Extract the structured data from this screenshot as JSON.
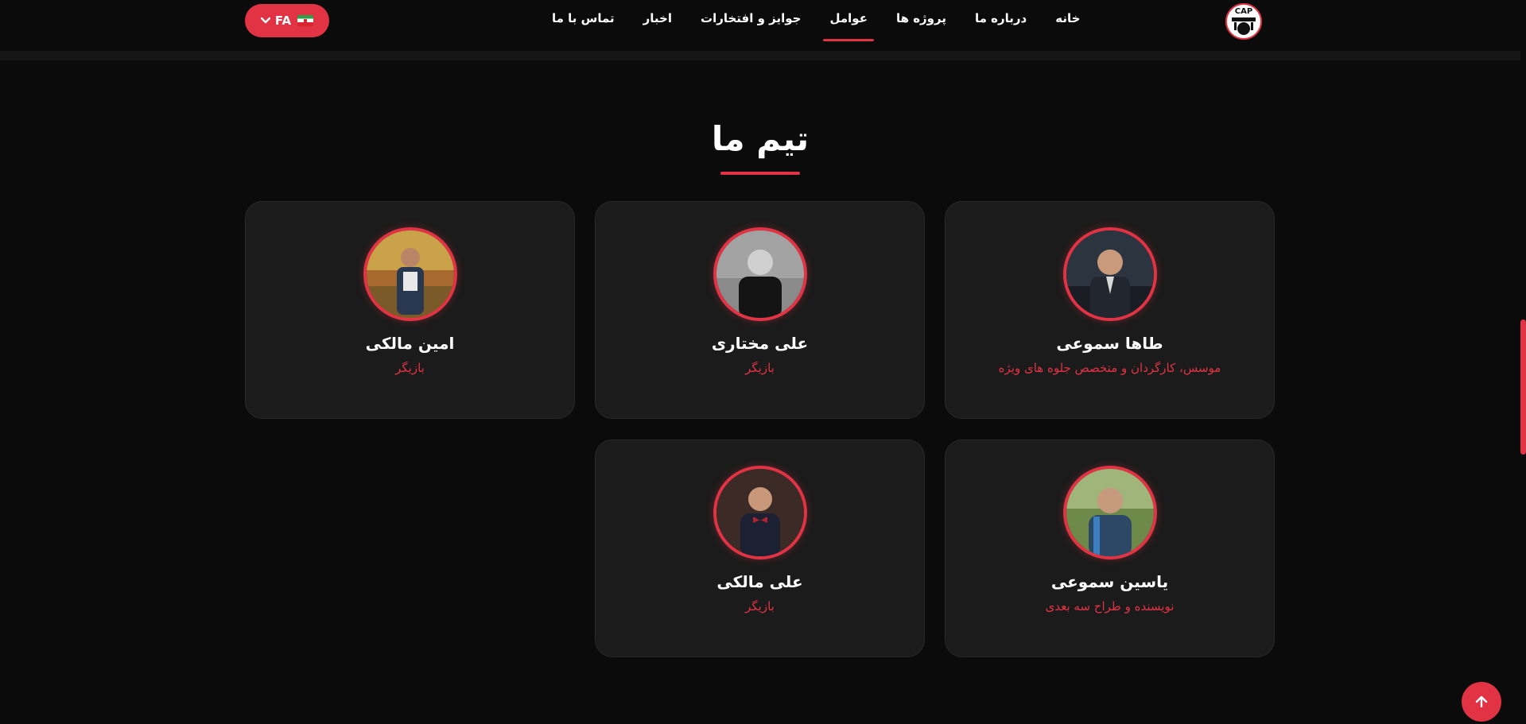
{
  "header": {
    "language": {
      "code": "FA",
      "flag_icon": "iran-flag-icon"
    },
    "nav": [
      {
        "label": "خانه",
        "active": false
      },
      {
        "label": "درباره ما",
        "active": false
      },
      {
        "label": "پروژه ها",
        "active": false
      },
      {
        "label": "عوامل",
        "active": true
      },
      {
        "label": "جوایز و افتخارات",
        "active": false
      },
      {
        "label": "اخبار",
        "active": false
      },
      {
        "label": "تماس با ما",
        "active": false
      }
    ],
    "logo_text": "CAP"
  },
  "section": {
    "title": "تیم ما"
  },
  "team": [
    {
      "name": "طاها سموعی",
      "role": "موسس، کارگردان و متخصص جلوه های ویژه"
    },
    {
      "name": "علی مختاری",
      "role": "بازیگر"
    },
    {
      "name": "امین مالکی",
      "role": "بازیگر"
    },
    {
      "name": "یاسین سموعی",
      "role": "نویسنده و طراح سه بعدی"
    },
    {
      "name": "علی مالکی",
      "role": "بازیگر"
    }
  ],
  "colors": {
    "accent": "#e13344",
    "background": "#0b0b0b",
    "card": "#1b1b1b"
  }
}
